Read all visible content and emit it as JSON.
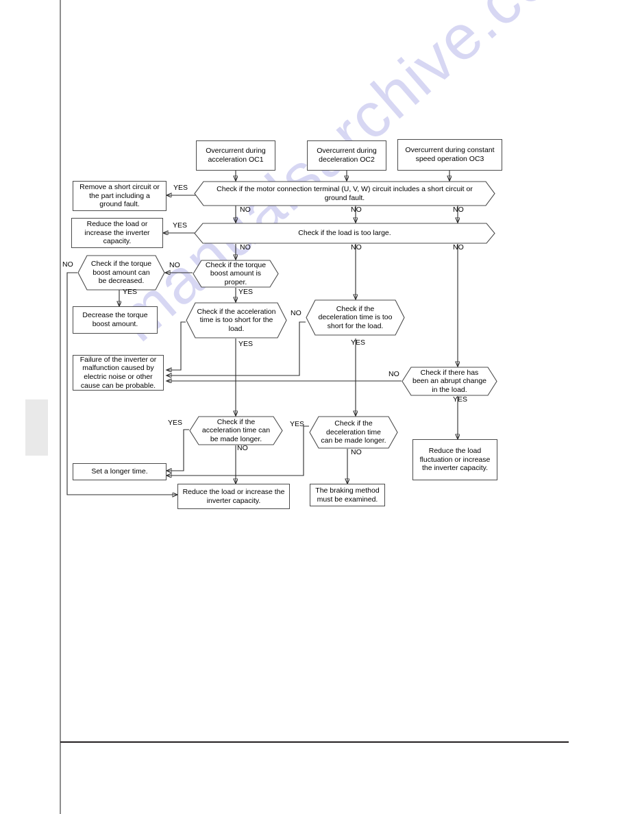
{
  "document": {
    "type": "service-manual-flowchart",
    "watermark_text": "manualsarchive.com"
  },
  "flowchart": {
    "title": "Overcurrent troubleshooting flowchart",
    "nodes": [
      {
        "id": "oc1",
        "shape": "rect",
        "text": "Overcurrent during acceleration OC1"
      },
      {
        "id": "oc2",
        "shape": "rect",
        "text": "Overcurrent during deceleration OC2"
      },
      {
        "id": "oc3",
        "shape": "rect",
        "text": "Overcurrent during constant speed operation OC3"
      },
      {
        "id": "check-short",
        "shape": "hex",
        "text": "Check if the motor connection terminal (U, V, W) circuit includes a short circuit or ground fault."
      },
      {
        "id": "remove-short",
        "shape": "rect",
        "text": "Remove a short circuit or the part including a ground fault."
      },
      {
        "id": "check-load",
        "shape": "hex",
        "text": "Check if the load is too large."
      },
      {
        "id": "reduce-load",
        "shape": "rect",
        "text": "Reduce the load or increase the inverter capacity."
      },
      {
        "id": "boost-proper",
        "shape": "hex",
        "text": "Check if the torque boost amount is proper."
      },
      {
        "id": "boost-decrease",
        "shape": "hex",
        "text": "Check if the torque boost amount can be decreased."
      },
      {
        "id": "do-decrease",
        "shape": "rect",
        "text": "Decrease the torque boost amount."
      },
      {
        "id": "accel-short",
        "shape": "hex",
        "text": "Check if the acceleration time is too short for the load."
      },
      {
        "id": "decel-short",
        "shape": "hex",
        "text": "Check if the deceleration time is too short for the load."
      },
      {
        "id": "abrupt-change",
        "shape": "hex",
        "text": "Check if there has been an abrupt change in the load."
      },
      {
        "id": "failure",
        "shape": "rect",
        "text": "Failure of the inverter or malfunction caused by electric noise or other cause can be probable."
      },
      {
        "id": "accel-longer",
        "shape": "hex",
        "text": "Check if the acceleration time can be made longer."
      },
      {
        "id": "decel-longer",
        "shape": "hex",
        "text": "Check if the deceleration time can be made longer."
      },
      {
        "id": "reduce-fluct",
        "shape": "rect",
        "text": "Reduce the load fluctuation or increase the inverter capacity."
      },
      {
        "id": "set-longer",
        "shape": "rect",
        "text": "Set a longer time."
      },
      {
        "id": "reduce-load-2",
        "shape": "rect",
        "text": "Reduce the load or increase the inverter capacity."
      },
      {
        "id": "braking",
        "shape": "rect",
        "text": "The braking method must be examined."
      }
    ],
    "edge_labels": {
      "short_yes": "YES",
      "short_no_1": "NO",
      "short_no_2": "NO",
      "short_no_3": "NO",
      "load_yes": "YES",
      "load_no_1": "NO",
      "load_no_2": "NO",
      "load_no_3": "NO",
      "boost_proper_no": "NO",
      "boost_proper_yes": "YES",
      "boost_dec_no": "NO",
      "boost_dec_yes": "YES",
      "accel_short_no": "NO",
      "accel_short_yes": "YES",
      "decel_short_no": "NO",
      "decel_short_yes": "YES",
      "abrupt_no": "NO",
      "abrupt_yes": "YES",
      "accel_long_yes": "YES",
      "accel_long_no": "NO",
      "decel_long_yes": "YES",
      "decel_long_no": "NO"
    }
  }
}
